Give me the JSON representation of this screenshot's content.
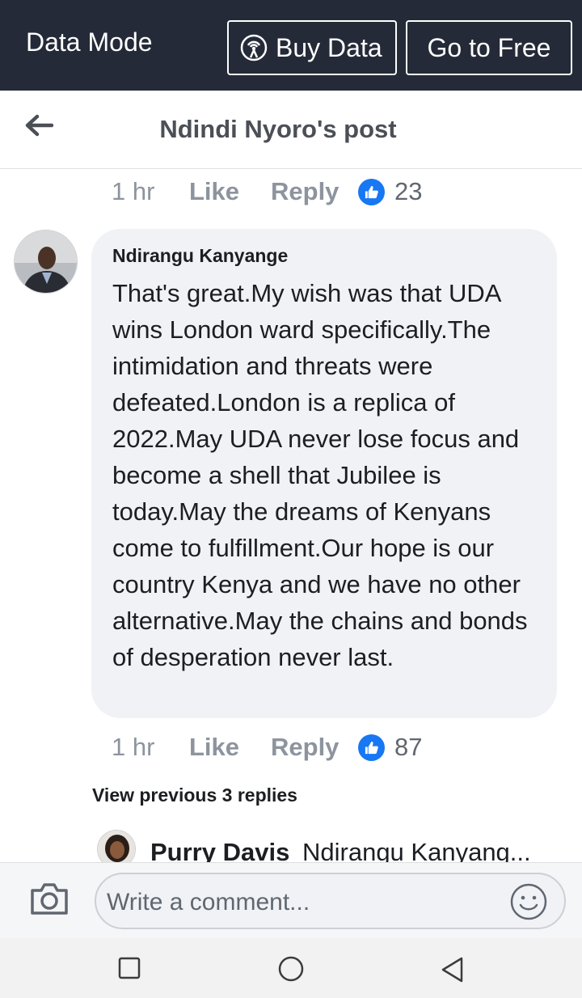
{
  "topbar": {
    "mode_label": "Data Mode",
    "buy_label": "Buy Data",
    "free_label": "Go to Free",
    "buy_icon": "signal-tower-icon"
  },
  "header": {
    "back_icon": "arrow-left-icon",
    "title": "Ndindi Nyoro's post"
  },
  "prev_comment_actions": {
    "time": "1 hr",
    "like": "Like",
    "reply": "Reply",
    "like_count": "23"
  },
  "comment": {
    "author": "Ndirangu Kanyange",
    "text": "That's great.My wish was that UDA wins London ward specifically.The intimidation and threats were defeated.London is a replica of 2022.May UDA never lose focus and become a shell that Jubilee is today.May the dreams of Kenyans come to fulfillment.Our hope is our country Kenya and we have no other alternative.May the chains and bonds of desperation never last.",
    "time": "1 hr",
    "like": "Like",
    "reply": "Reply",
    "like_count": "87"
  },
  "view_previous": "View previous 3 replies",
  "reply_preview": {
    "author": "Purry Davis",
    "text": "Ndirangu Kanyang..."
  },
  "composer": {
    "placeholder": "Write a comment...",
    "camera_icon": "camera-icon",
    "emoji_icon": "smiley-icon"
  },
  "navbar": {
    "icons": [
      "square-recents-icon",
      "circle-home-icon",
      "triangle-back-icon"
    ]
  },
  "colors": {
    "topbar_bg": "#242a37",
    "like_blue": "#1877f2",
    "bubble_bg": "#f0f2f5",
    "muted_text": "#8d949e"
  }
}
